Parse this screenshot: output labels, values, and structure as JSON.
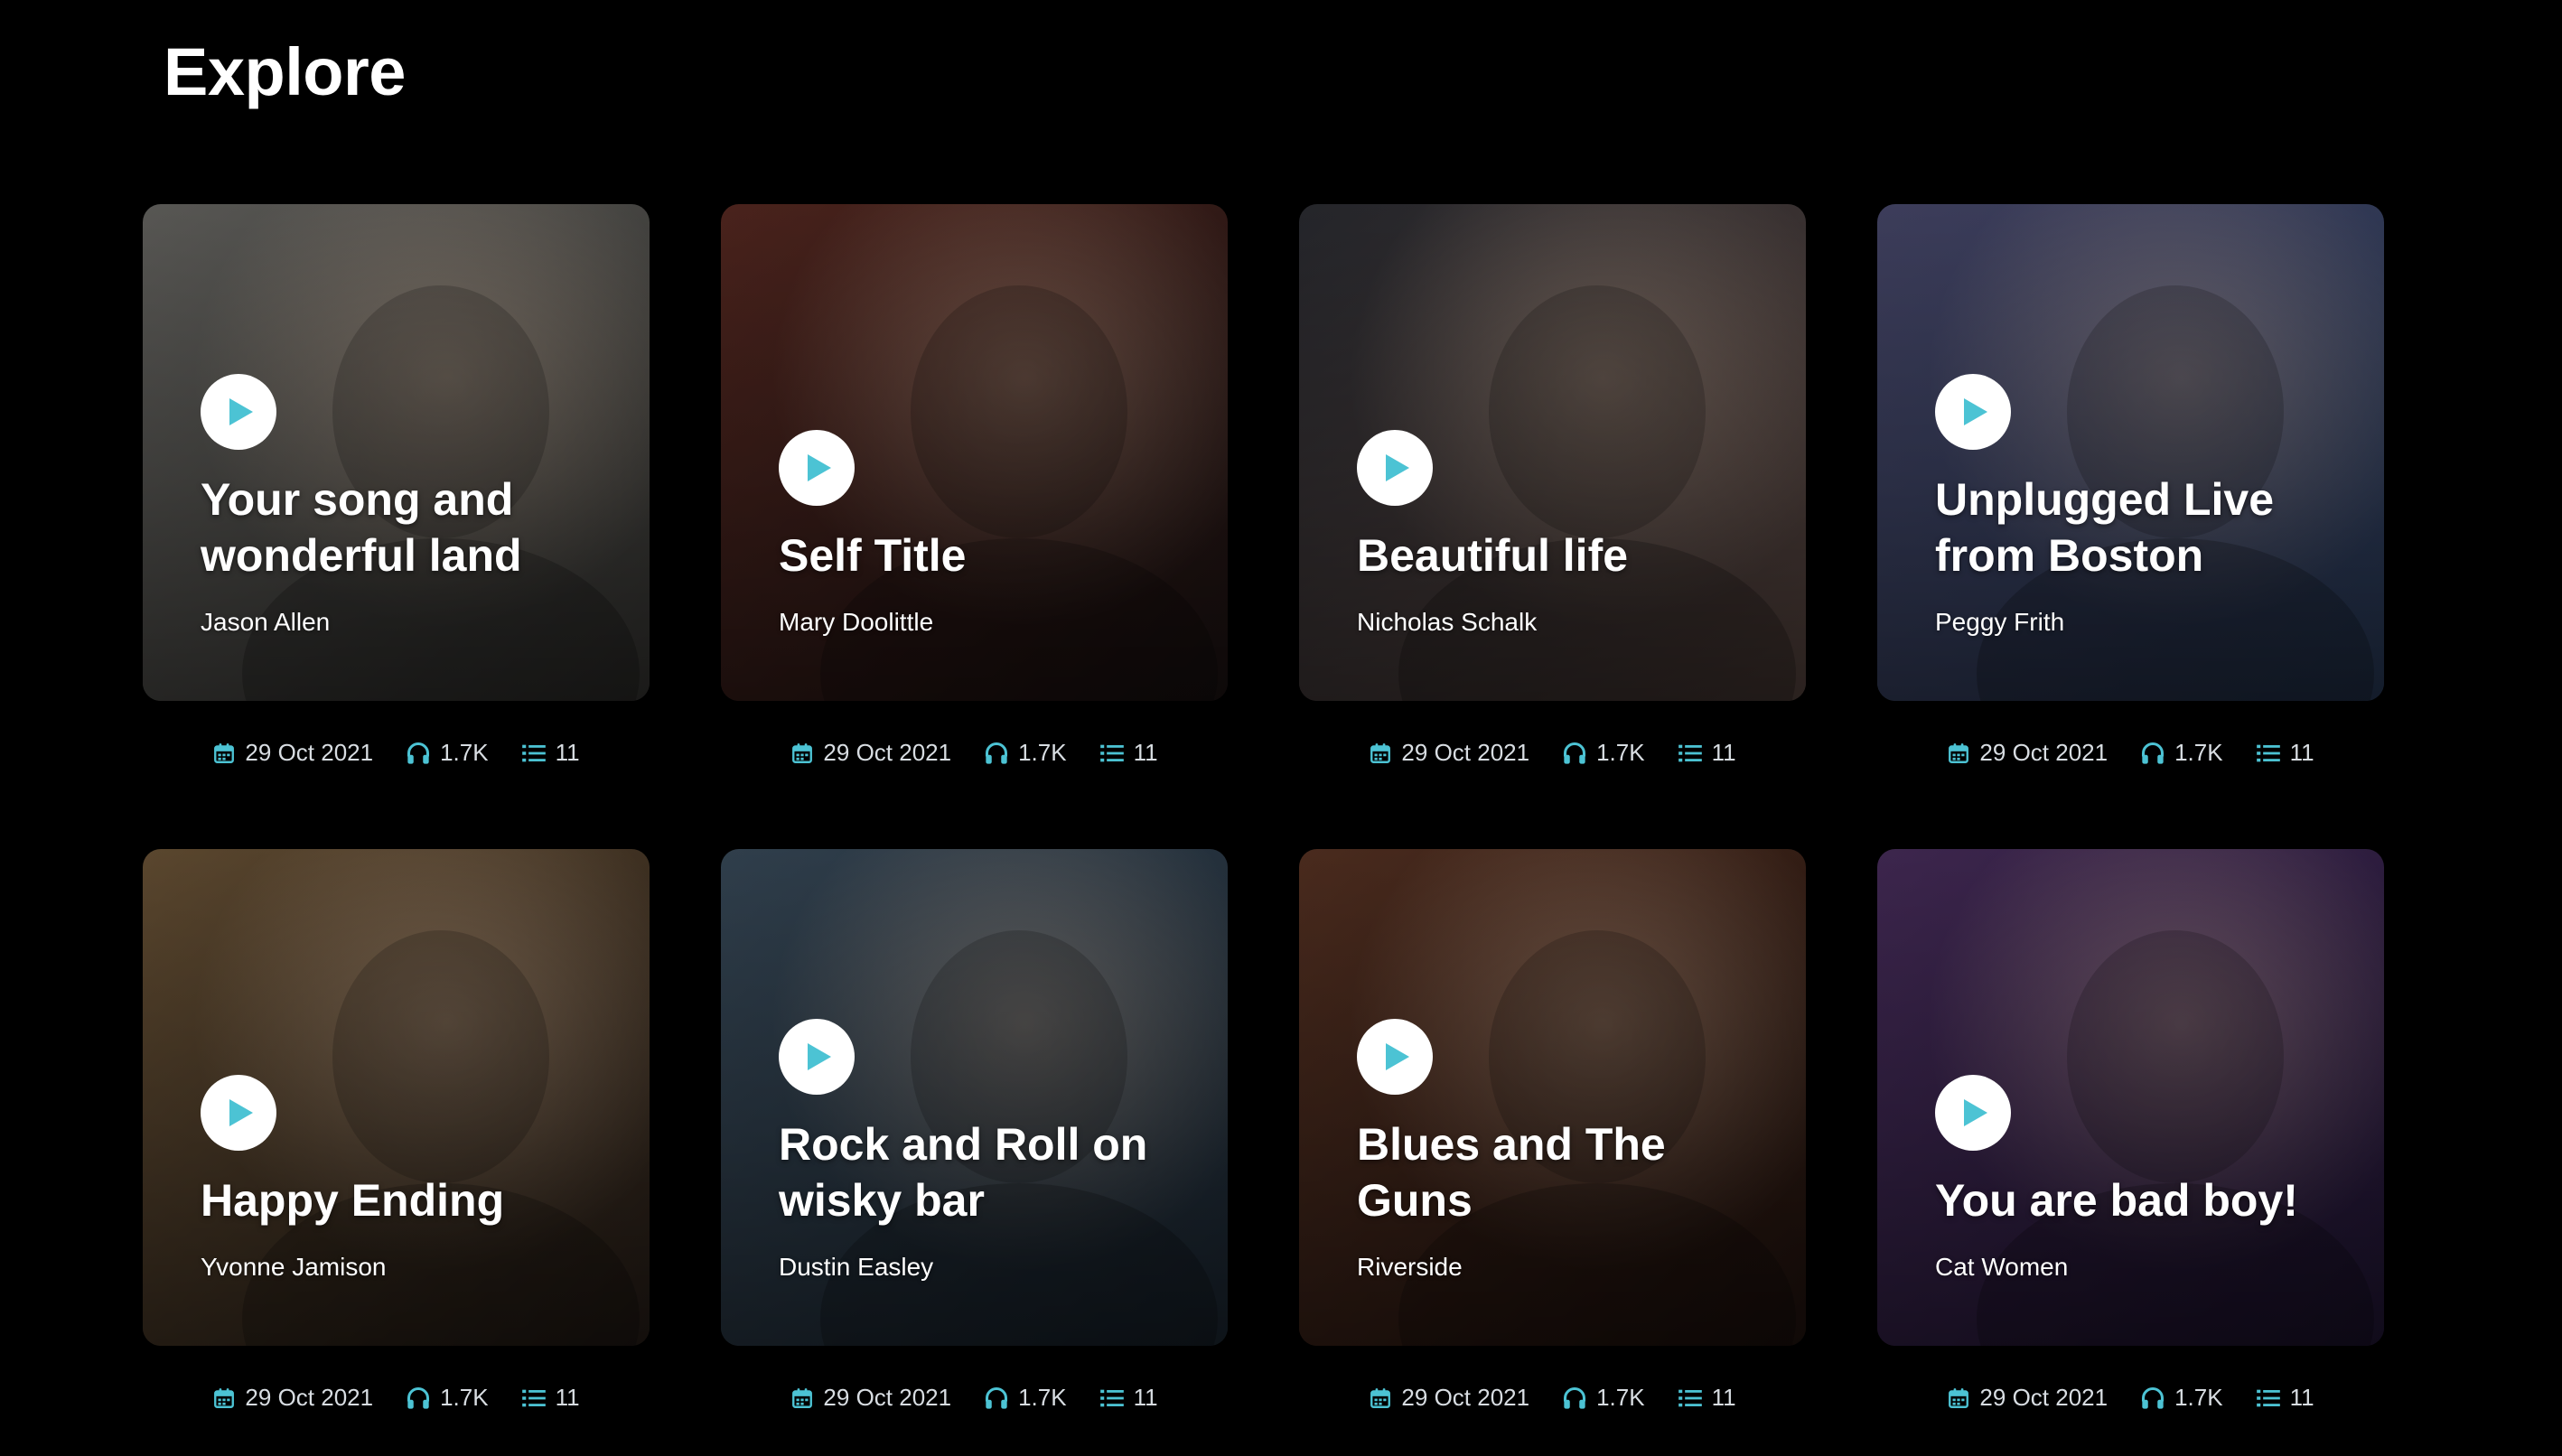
{
  "page": {
    "title": "Explore"
  },
  "colors": {
    "accent": "#4cc3d4",
    "background": "#000000",
    "meta_text": "#d8dde2"
  },
  "icons": {
    "date": "calendar-icon",
    "plays": "headphones-icon",
    "tracks": "list-icon",
    "play": "play-icon"
  },
  "albums": [
    {
      "title": "Your song and wonderful land",
      "artist": "Jason Allen",
      "date": "29 Oct 2021",
      "plays": "1.7K",
      "tracks": "11",
      "bg": [
        "#6b6a66",
        "#3a3936"
      ]
    },
    {
      "title": "Self Title",
      "artist": "Mary Doolittle",
      "date": "29 Oct 2021",
      "plays": "1.7K",
      "tracks": "11",
      "bg": [
        "#5a2a22",
        "#1d1414"
      ]
    },
    {
      "title": "Beautiful life",
      "artist": "Nicholas Schalk",
      "date": "29 Oct 2021",
      "plays": "1.7K",
      "tracks": "11",
      "bg": [
        "#2c2d33",
        "#5e4a44"
      ]
    },
    {
      "title": "Unplugged Live from Boston",
      "artist": "Peggy Frith",
      "date": "29 Oct 2021",
      "plays": "1.7K",
      "tracks": "11",
      "bg": [
        "#4a4a6e",
        "#2b3e5e"
      ]
    },
    {
      "title": "Happy Ending",
      "artist": "Yvonne Jamison",
      "date": "29 Oct 2021",
      "plays": "1.7K",
      "tracks": "11",
      "bg": [
        "#6e5638",
        "#2a201a"
      ]
    },
    {
      "title": "Rock and Roll on wisky bar",
      "artist": "Dustin Easley",
      "date": "29 Oct 2021",
      "plays": "1.7K",
      "tracks": "11",
      "bg": [
        "#3a4c5c",
        "#1e2a36"
      ]
    },
    {
      "title": "Blues and The Guns",
      "artist": "Riverside",
      "date": "29 Oct 2021",
      "plays": "1.7K",
      "tracks": "11",
      "bg": [
        "#5a3424",
        "#23140f"
      ]
    },
    {
      "title": "You are bad boy!",
      "artist": "Cat Women",
      "date": "29 Oct 2021",
      "plays": "1.7K",
      "tracks": "11",
      "bg": [
        "#4a2e5e",
        "#24183a"
      ]
    }
  ]
}
